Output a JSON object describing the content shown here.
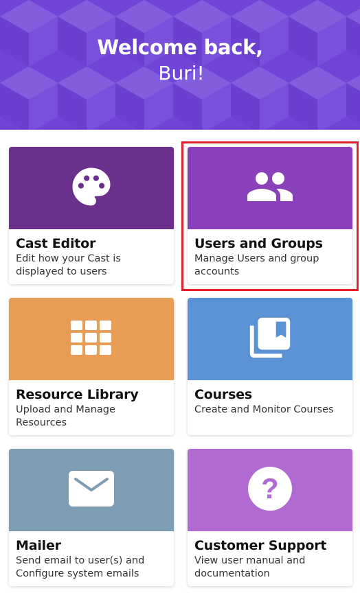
{
  "header": {
    "welcome_line1": "Welcome back,",
    "welcome_line2": "Buri!",
    "background_color": "#6f44d6"
  },
  "cards": [
    {
      "title": "Cast Editor",
      "description": "Edit how your Cast is displayed to users",
      "icon": "palette-icon",
      "color": "#6b2f8c"
    },
    {
      "title": "Users and Groups",
      "description": "Manage Users and group accounts",
      "icon": "users-icon",
      "color": "#8a40b8"
    },
    {
      "title": "Resource Library",
      "description": "Upload and Manage Resources",
      "icon": "grid-icon",
      "color": "#e89d57"
    },
    {
      "title": "Courses",
      "description": "Create and Monitor Courses",
      "icon": "library-books-icon",
      "color": "#5b92d6"
    },
    {
      "title": "Mailer",
      "description": "Send email to user(s) and Configure system emails",
      "icon": "mail-icon",
      "color": "#7d9db5"
    },
    {
      "title": "Customer Support",
      "description": "View user manual and documentation",
      "icon": "help-icon",
      "color": "#b06ad2"
    }
  ],
  "highlight": {
    "target": "Users and Groups",
    "color": "#e0202c"
  }
}
